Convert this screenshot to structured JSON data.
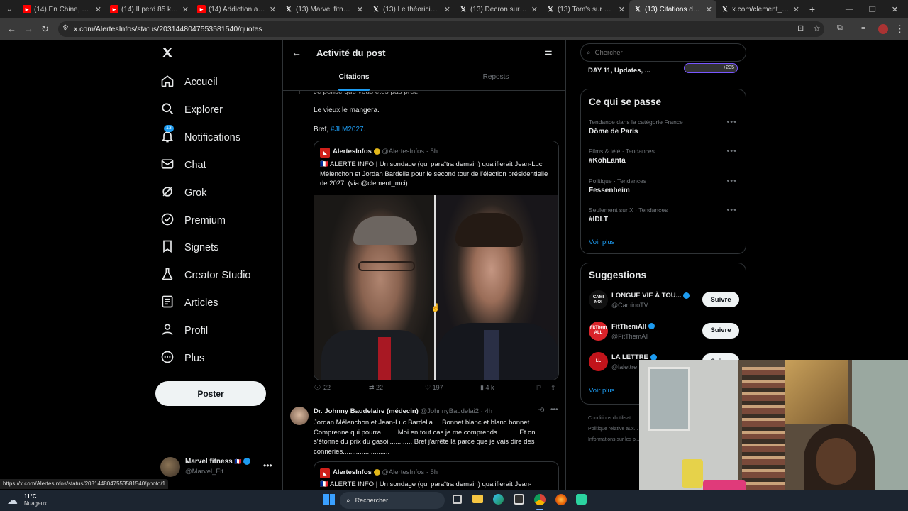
{
  "browser": {
    "tabs": [
      {
        "title": "(14) En Chine, ces ent",
        "icon": "youtube-icon"
      },
      {
        "title": "(14) Il perd 85 kg en",
        "icon": "youtube-icon"
      },
      {
        "title": "(14) Addiction au spo",
        "icon": "youtube-icon"
      },
      {
        "title": "(13) Marvel fitness re",
        "icon": "x-icon"
      },
      {
        "title": "(13) Le théoricien sur",
        "icon": "x-icon"
      },
      {
        "title": "(13) Decron sur X : \"",
        "icon": "x-icon"
      },
      {
        "title": "(13) Tom's sur X : \"Le",
        "icon": "x-icon"
      },
      {
        "title": "(13) Citations de ce p",
        "icon": "x-icon",
        "active": true
      },
      {
        "title": "x.com/clement_mci",
        "icon": "x-icon"
      }
    ],
    "url": "x.com/AlertesInfos/status/2031448047553581540/quotes",
    "status_url": "https://x.com/AlertesInfos/status/2031448047553581540/photo/1"
  },
  "sidebar": {
    "items": [
      {
        "label": "Accueil",
        "icon": "home-icon"
      },
      {
        "label": "Explorer",
        "icon": "search-icon"
      },
      {
        "label": "Notifications",
        "icon": "bell-icon",
        "badge": "13"
      },
      {
        "label": "Chat",
        "icon": "mail-icon"
      },
      {
        "label": "Grok",
        "icon": "grok-icon"
      },
      {
        "label": "Premium",
        "icon": "verified-icon"
      },
      {
        "label": "Signets",
        "icon": "bookmark-icon"
      },
      {
        "label": "Creator Studio",
        "icon": "flask-icon"
      },
      {
        "label": "Articles",
        "icon": "article-icon"
      },
      {
        "label": "Profil",
        "icon": "person-icon"
      },
      {
        "label": "Plus",
        "icon": "more-circle-icon"
      }
    ],
    "post_button": "Poster",
    "account": {
      "name": "Marvel fitness",
      "flag": "🇫🇷",
      "handle": "@Marvel_Flt"
    }
  },
  "header": {
    "title": "Activité du post",
    "tabs": [
      "Citations",
      "Reposts"
    ]
  },
  "post1": {
    "line0": "Je pense que vous êtes pas prêt.",
    "line1": "Le vieux le mangera.",
    "line2_prefix": "Bref, ",
    "hashtag": "#JLM2027",
    "line2_suffix": ".",
    "quoted": {
      "name": "AlertesInfos",
      "handle": "@AlertesInfos",
      "time": "· 5h",
      "text": "🇫🇷 ALERTE INFO | Un sondage (qui paraîtra demain) qualifierait Jean-Luc Mélenchon et Jordan Bardella pour le second tour de l'élection présidentielle de 2027. (via @clement_mci)"
    },
    "stats": {
      "replies": "22",
      "reposts": "22",
      "likes": "197",
      "views": "4 k"
    }
  },
  "post2": {
    "name": "Dr. Johnny Baudelaire (médecin)",
    "handle": "@JohnnyBaudelai2",
    "time": "· 4h",
    "text": "Jordan Mélenchon et Jean-Luc Bardella.... Bonnet blanc et blanc bonnet.... Comprenne qui pourra........ Moi en tout cas je me comprends........... Et on s'étonne du prix du gasoil............ Bref j'arrête là parce que je vais dire des conneries.........................",
    "quoted": {
      "name": "AlertesInfos",
      "handle": "@AlertesInfos",
      "time": "· 5h",
      "text": "🇫🇷 ALERTE INFO | Un sondage (qui paraîtra demain) qualifierait Jean-"
    }
  },
  "right": {
    "search_placeholder": "Chercher",
    "top_item": "DAY 11, Updates, ...",
    "top_badge": "+235",
    "trends_title": "Ce qui se passe",
    "trends": [
      {
        "meta": "Tendance dans la catégorie France",
        "name": "Dôme de Paris"
      },
      {
        "meta": "Films & télé · Tendances",
        "name": "#KohLanta"
      },
      {
        "meta": "Politique · Tendances",
        "name": "Fessenheim"
      },
      {
        "meta": "Seulement sur X · Tendances",
        "name": "#IDLT"
      }
    ],
    "see_more": "Voir plus",
    "suggestions_title": "Suggestions",
    "suggestions": [
      {
        "name": "LONGUE VIE À TOU...",
        "handle": "@CaminoTV",
        "avatar": "CAMI NO!",
        "button": "Suivre"
      },
      {
        "name": "FitThemAll",
        "handle": "@FitThemAll",
        "avatar": "FitThem ALL",
        "button": "Suivre"
      },
      {
        "name": "LA LETTRE",
        "handle": "@lalettre",
        "avatar": "LL",
        "button": "Suivre"
      }
    ],
    "see_more2": "Voir plus",
    "footer": [
      "Conditions d'utilisat...",
      "Politique relative aux...",
      "Informations sur les p..."
    ]
  },
  "taskbar": {
    "temp": "11°C",
    "weather": "Nuageux",
    "search": "Rechercher"
  },
  "colors": {
    "accent": "#1d9bf0",
    "bg": "#000000",
    "border": "#2f3336",
    "muted": "#71767b"
  }
}
